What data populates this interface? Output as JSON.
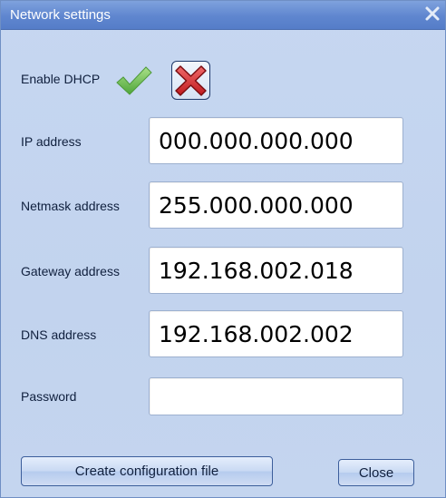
{
  "window": {
    "title": "Network settings",
    "close_icon": "close-icon"
  },
  "dhcp": {
    "label": "Enable DHCP",
    "enable_icon": "checkmark-icon",
    "disable_icon": "red-x-icon"
  },
  "fields": {
    "ip": {
      "label": "IP address",
      "value": "000.000.000.000"
    },
    "netmask": {
      "label": "Netmask address",
      "value": "255.000.000.000"
    },
    "gateway": {
      "label": "Gateway address",
      "value": "192.168.002.018"
    },
    "dns": {
      "label": "DNS address",
      "value": "192.168.002.002"
    },
    "password": {
      "label": "Password",
      "value": ""
    }
  },
  "buttons": {
    "create": "Create configuration file",
    "close": "Close"
  },
  "colors": {
    "title_bar": "#5f86cf",
    "dialog_bg": "#c4d5ef",
    "check_green": "#6cc04a",
    "x_red": "#d8232a"
  }
}
